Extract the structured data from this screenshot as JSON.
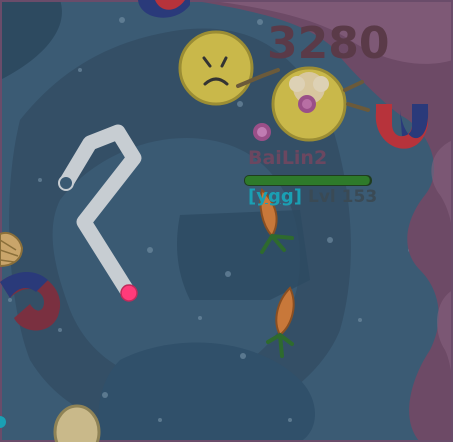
{
  "hud": {
    "score": "3280"
  },
  "player": {
    "name": "BaiLin2",
    "clan": "[ygg]",
    "level": "Lvl 153",
    "health_fraction": 0.99
  },
  "icons": {
    "enemy_player": "sad-face-icon",
    "player_avatar": "flower-face-icon",
    "snake_trail": "trail-icon",
    "magnet": "magnet-icon",
    "carrot": "carrot-icon",
    "shell": "shell-icon",
    "egg": "egg-icon"
  },
  "colors": {
    "water": "#3a5a73",
    "coral": "#6d4a66",
    "health_fill": "#2e7a2a",
    "trail": "#c7cdd2",
    "orb": "#ff3b7a"
  }
}
